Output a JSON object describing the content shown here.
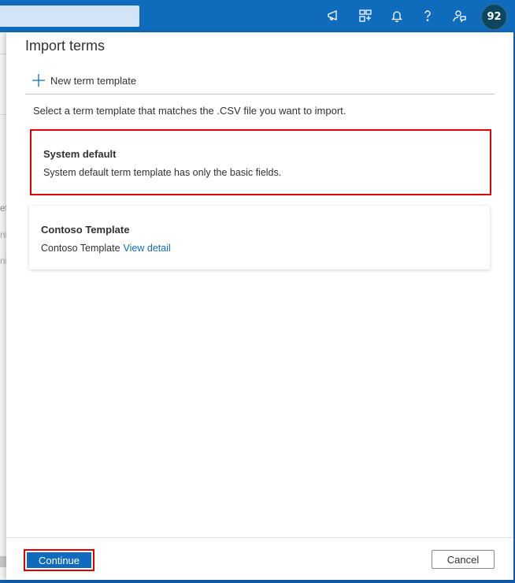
{
  "header": {
    "avatar_initials": "92",
    "icons": [
      "megaphone-icon",
      "switch-icon",
      "bell-icon",
      "help-icon",
      "feedback-icon"
    ],
    "accent": "#0f6cbd"
  },
  "background": {
    "fragments": [
      "ef",
      "ni",
      "ni"
    ]
  },
  "panel": {
    "title": "Import terms",
    "new_template_label": "New term template",
    "instruction": "Select a term template that matches the .CSV file you want to import.",
    "templates": [
      {
        "title": "System default",
        "description": "System default term template has only the basic fields.",
        "selected": true
      },
      {
        "title": "Contoso Template",
        "description": "Contoso Template",
        "link": "View detail",
        "selected": false
      }
    ],
    "footer": {
      "continue_label": "Continue",
      "cancel_label": "Cancel"
    }
  }
}
